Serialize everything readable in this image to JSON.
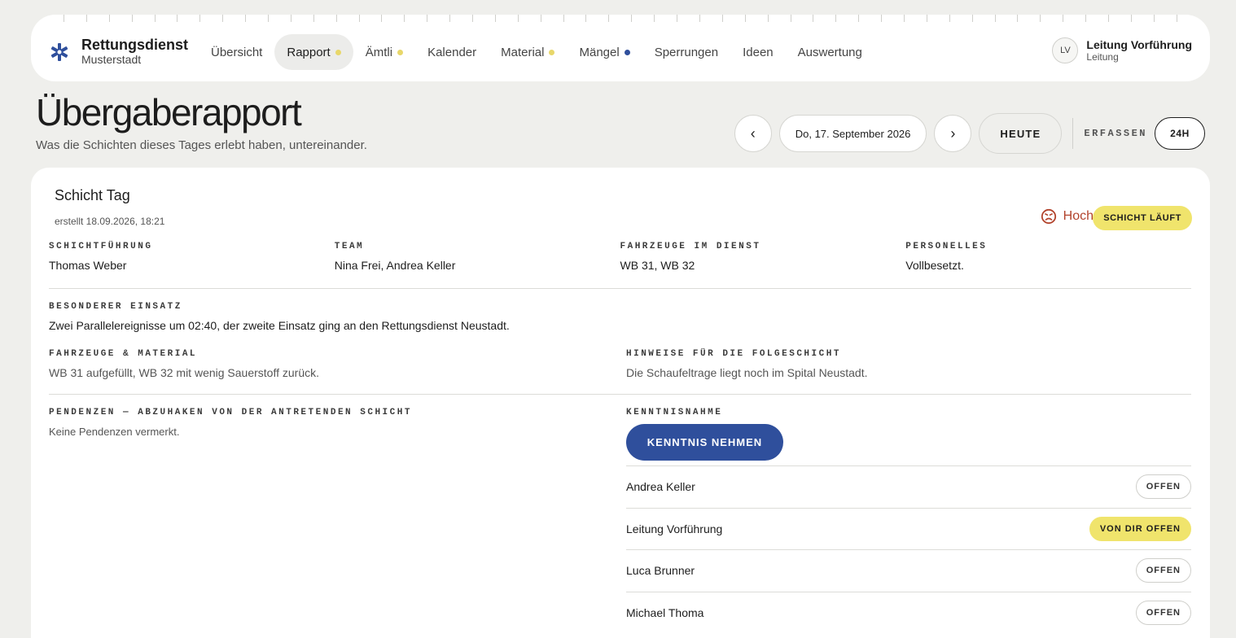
{
  "brand": {
    "name": "Rettungsdienst",
    "subtitle": "Musterstadt",
    "icon": "star-of-life-icon"
  },
  "nav": [
    {
      "label": "Übersicht",
      "active": false,
      "dot": null
    },
    {
      "label": "Rapport",
      "active": true,
      "dot": "yellow"
    },
    {
      "label": "Ämtli",
      "active": false,
      "dot": "yellow"
    },
    {
      "label": "Kalender",
      "active": false,
      "dot": null
    },
    {
      "label": "Material",
      "active": false,
      "dot": "yellow"
    },
    {
      "label": "Mängel",
      "active": false,
      "dot": "blue"
    },
    {
      "label": "Sperrungen",
      "active": false,
      "dot": null
    },
    {
      "label": "Ideen",
      "active": false,
      "dot": null
    },
    {
      "label": "Auswertung",
      "active": false,
      "dot": null
    }
  ],
  "user": {
    "initials": "LV",
    "name": "Leitung Vorführung",
    "role": "Leitung"
  },
  "page": {
    "title": "Übergaberapport",
    "subtitle": "Was die Schichten dieses Tages erlebt haben, untereinander."
  },
  "date_controls": {
    "prev": "‹",
    "date": "Do, 17. September 2026",
    "next": "›",
    "today": "HEUTE",
    "erfassen": "ERFASSEN",
    "mode": "24H"
  },
  "shift": {
    "title": "Schicht Tag",
    "created": "erstellt 18.09.2026, 18:21",
    "mood": "Hoch",
    "status": "SCHICHT LÄUFT",
    "fields": {
      "lead_label": "Schichtführung",
      "lead": "Thomas Weber",
      "team_label": "Team",
      "team": "Nina Frei, Andrea Keller",
      "vehicles_label": "Fahrzeuge im Dienst",
      "vehicles": "WB 31, WB 32",
      "personnel_label": "Personelles",
      "personnel": "Vollbesetzt.",
      "special_label": "Besonderer Einsatz",
      "special": "Zwei Parallelereignisse um 02:40, der zweite Einsatz ging an den Rettungsdienst Neustadt.",
      "material_label": "Fahrzeuge & Material",
      "material": "WB 31 aufgefüllt, WB 32 mit wenig Sauerstoff zurück.",
      "notes_label": "Hinweise für die Folgeschicht",
      "notes": "Die Schaufeltrage liegt noch im Spital Neustadt.",
      "pending_label": "Pendenzen — abzuhaken von der antretenden Schicht",
      "pending": "Keine Pendenzen vermerkt.",
      "ack_label": "Kenntnisnahme"
    },
    "ack_button": "KENNTNIS NEHMEN",
    "acknowledgements": [
      {
        "name": "Andrea Keller",
        "status": "OFFEN",
        "mine": false
      },
      {
        "name": "Leitung Vorführung",
        "status": "VON DIR OFFEN",
        "mine": true
      },
      {
        "name": "Luca Brunner",
        "status": "OFFEN",
        "mine": false
      },
      {
        "name": "Michael Thoma",
        "status": "OFFEN",
        "mine": false
      }
    ]
  },
  "colors": {
    "accent": "#2f4f9c",
    "status_yellow": "#f0e46c",
    "mood_red": "#b2432c",
    "background": "#efefec"
  }
}
